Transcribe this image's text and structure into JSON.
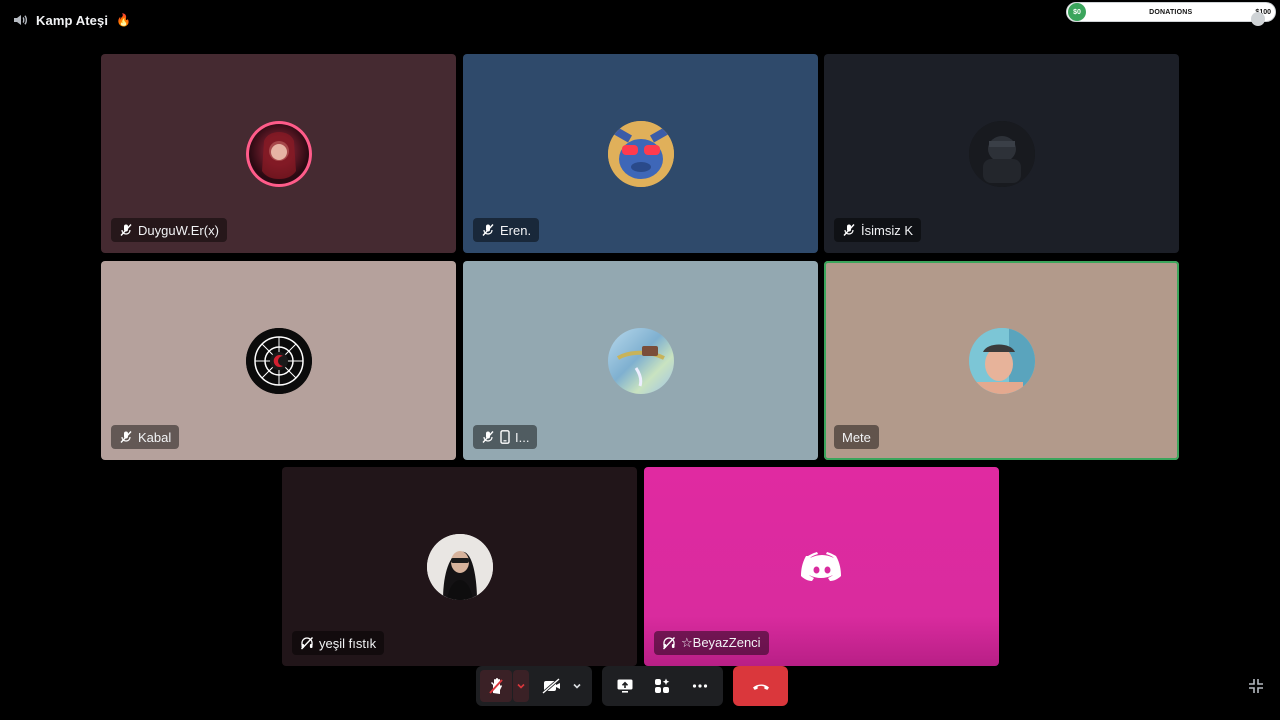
{
  "channel": {
    "name": "Kamp Ateşi",
    "emoji": "🔥",
    "icon": "speaker-icon"
  },
  "donations": {
    "coin_label": "$0",
    "label": "DONATIONS",
    "amount": "$100",
    "progress": 0.0
  },
  "participants": [
    {
      "name": "DuyguW.Er(x)",
      "muted": true,
      "bg": "#452a31"
    },
    {
      "name": "Eren.",
      "muted": true,
      "bg": "#2f4a6b"
    },
    {
      "name": "İsimsiz K",
      "muted": true,
      "bg": "#1c1f27"
    },
    {
      "name": "Kabal",
      "muted": true,
      "bg": "#b5a19c"
    },
    {
      "name": "I...",
      "muted": true,
      "mobile": true,
      "bg": "#93a8b1"
    },
    {
      "name": "Mete",
      "muted": false,
      "speaking": true,
      "bg": "#b29a8b"
    },
    {
      "name": "yeşil fıstık",
      "muted": true,
      "deafened": true,
      "bg": "#211519"
    },
    {
      "name": "☆BeyazZenci",
      "muted": true,
      "deafened": true,
      "bg": "#d92b9e",
      "discord_default_avatar": true
    }
  ],
  "controls": {
    "mic_state": "muted",
    "camera_state": "off",
    "icons": [
      "hand-mic-icon",
      "chevron-down-icon",
      "camera-off-icon",
      "chevron-down-icon",
      "screen-share-icon",
      "activities-icon",
      "more-icon",
      "hangup-icon"
    ]
  },
  "accent_colors": {
    "hangup": "#da373c",
    "speaking": "#3ba55c",
    "control_bg": "#1e1f22"
  }
}
